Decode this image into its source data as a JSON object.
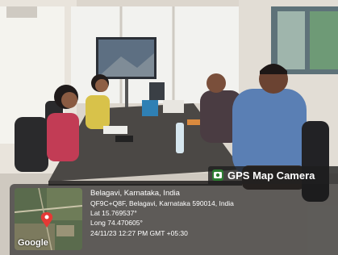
{
  "overlay": {
    "app_name": "GPS Map Camera",
    "app_icon": "gps-map-camera-icon",
    "map_brand": "Google",
    "location_title": "Belagavi, Karnataka, India",
    "address": "QF9C+Q8F, Belagavi, Karnataka 590014, India",
    "latitude": "Lat 15.769537°",
    "longitude": "Long 74.470605°",
    "timestamp": "24/11/23 12:27 PM GMT +05:30"
  },
  "colors": {
    "overlay_bg": "#191919",
    "marker": "#e53935"
  }
}
